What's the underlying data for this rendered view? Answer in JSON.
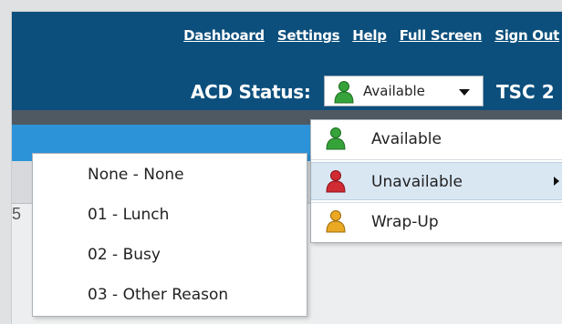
{
  "header": {
    "nav": [
      "Dashboard",
      "Settings",
      "Help",
      "Full Screen",
      "Sign Out"
    ],
    "acd_label": "ACD Status:",
    "status_value": "Available",
    "tenant": "TSC 2"
  },
  "status_menu": {
    "items": [
      {
        "label": "Available",
        "icon": "person-green-icon",
        "color": "#2e9a2e"
      },
      {
        "label": "Unavailable",
        "icon": "person-red-icon",
        "color": "#c8202a",
        "has_submenu": true
      },
      {
        "label": "Wrap-Up",
        "icon": "person-orange-icon",
        "color": "#e7a21c"
      }
    ]
  },
  "reason_menu": {
    "items": [
      "None - None",
      "01 - Lunch",
      "02 - Busy",
      "03 - Other Reason"
    ]
  },
  "colors": {
    "header_bg": "#0c4f7c",
    "accent_bar": "#2d93d9",
    "highlight": "#d9e7f3"
  },
  "tab_glyph": "5"
}
